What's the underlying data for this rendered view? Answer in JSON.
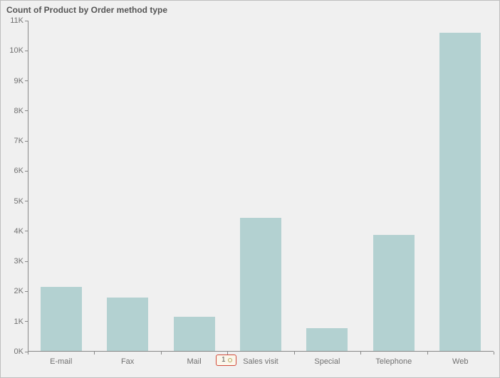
{
  "chart_data": {
    "type": "bar",
    "title": "Count of Product by Order method type",
    "xlabel": "",
    "ylabel": "",
    "categories": [
      "E-mail",
      "Fax",
      "Mail",
      "Sales visit",
      "Special",
      "Telephone",
      "Web"
    ],
    "values": [
      2150,
      1800,
      1150,
      4450,
      780,
      3880,
      10600
    ],
    "ylim": [
      0,
      11000
    ],
    "y_ticks": [
      0,
      1000,
      2000,
      3000,
      4000,
      5000,
      6000,
      7000,
      8000,
      9000,
      10000,
      11000
    ],
    "y_tick_labels": [
      "0K",
      "1K",
      "2K",
      "3K",
      "4K",
      "5K",
      "6K",
      "7K",
      "8K",
      "9K",
      "10K",
      "11K"
    ]
  },
  "annotation": {
    "label": "1"
  },
  "colors": {
    "bar_fill": "#b3d1d1",
    "plot_bg": "#f0f0f0",
    "axis": "#888",
    "text": "#707070",
    "badge_border": "#d24a3a",
    "badge_bg": "#fbf7ec"
  }
}
